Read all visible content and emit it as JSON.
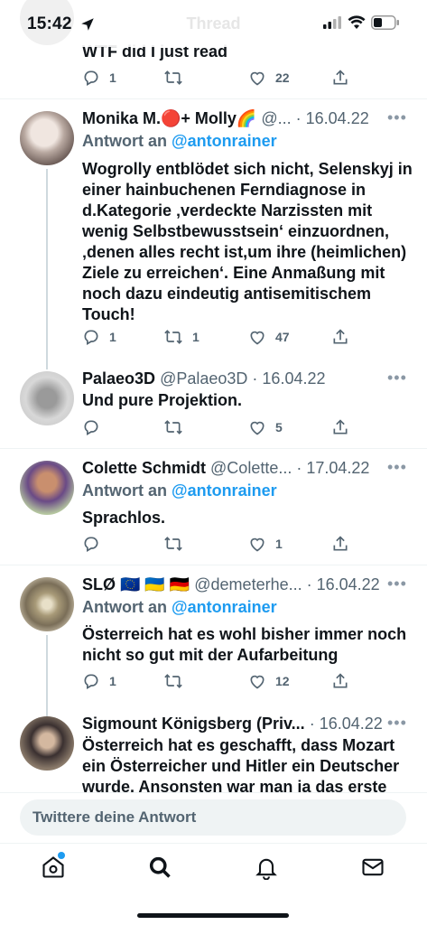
{
  "status": {
    "time": "15:42",
    "faded_title": "Thread"
  },
  "top_tweet": {
    "text": "WTF did I just read",
    "replies": "1",
    "retweets": "",
    "likes": "22"
  },
  "tweets": [
    {
      "name": "Monika M.🔴+ Molly🌈",
      "handle": "@...",
      "date": "· 16.04.22",
      "reply_prefix": "Antwort an",
      "reply_to": "@antonrainer",
      "text": "Wogrolly entblödet sich nicht, Selenskyj in einer hainbuchenen Ferndiagnose in d.Kategorie ‚verdeckte Narzissten mit wenig Selbstbewusstsein‘ einzuordnen, ‚denen alles recht ist,um ihre (heimlichen) Ziele zu erreichen‘. Eine Anmaßung mit noch dazu eindeutig antisemitischem Touch!",
      "replies": "1",
      "retweets": "1",
      "likes": "47"
    },
    {
      "name": "Palaeo3D",
      "handle": "@Palaeo3D",
      "date": "· 16.04.22",
      "reply_prefix": "",
      "reply_to": "",
      "text": "Und pure Projektion.",
      "replies": "",
      "retweets": "",
      "likes": "5"
    },
    {
      "name": "Colette Schmidt",
      "handle": "@Colette...",
      "date": "· 17.04.22",
      "reply_prefix": "Antwort an",
      "reply_to": "@antonrainer",
      "text": "Sprachlos.",
      "replies": "",
      "retweets": "",
      "likes": "1"
    },
    {
      "name": "SLØ 🇪🇺 🇺🇦 🇩🇪",
      "handle": "@demeterhe...",
      "date": "· 16.04.22",
      "reply_prefix": "Antwort an",
      "reply_to": "@antonrainer",
      "text": "Österreich hat es wohl bisher immer noch nicht so gut mit der Aufarbeitung",
      "replies": "1",
      "retweets": "",
      "likes": "12"
    },
    {
      "name": "Sigmount Königsberg (Priv...",
      "handle": "",
      "date": "· 16.04.22",
      "reply_prefix": "",
      "reply_to": "",
      "text": "Österreich hat es geschafft, dass Mozart ein Österreicher und Hitler ein Deutscher wurde. Ansonsten war man ja das erste",
      "replies": "",
      "retweets": "",
      "likes": ""
    }
  ],
  "compose": {
    "placeholder": "Twittere deine Antwort"
  },
  "tabs": [
    "home-icon",
    "search-icon",
    "notifications-icon",
    "messages-icon"
  ],
  "colors": {
    "accent": "#1d9bf0",
    "text": "#0f1419",
    "muted": "#536471"
  }
}
